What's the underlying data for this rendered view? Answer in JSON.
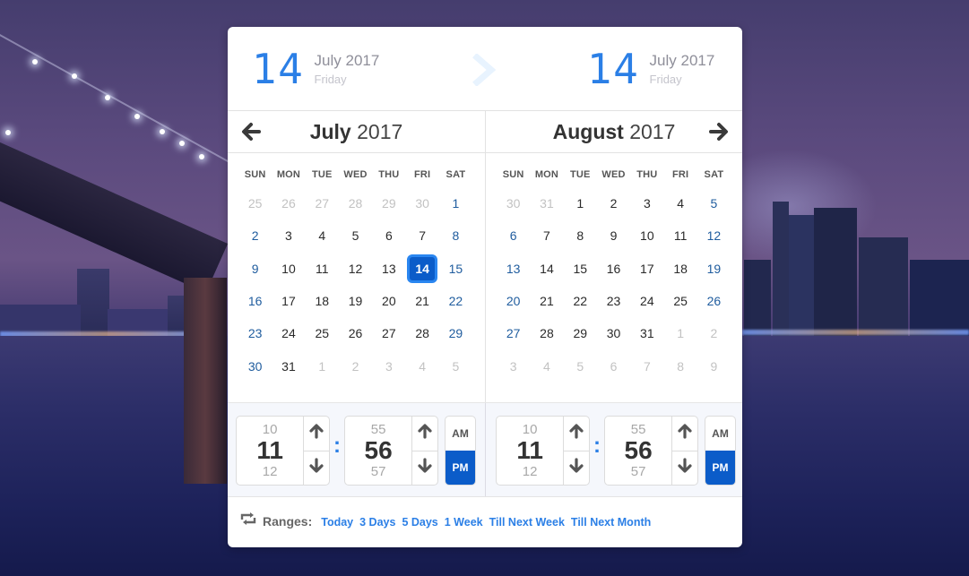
{
  "summary": {
    "start": {
      "day": "14",
      "month_year": "July 2017",
      "weekday": "Friday"
    },
    "end": {
      "day": "14",
      "month_year": "July 2017",
      "weekday": "Friday"
    }
  },
  "calendars": [
    {
      "month": "July",
      "year": "2017",
      "nav": "prev",
      "weekdays": [
        "SUN",
        "MON",
        "TUE",
        "WED",
        "THU",
        "FRI",
        "SAT"
      ],
      "days": [
        {
          "d": "25",
          "t": "muted"
        },
        {
          "d": "26",
          "t": "muted"
        },
        {
          "d": "27",
          "t": "muted"
        },
        {
          "d": "28",
          "t": "muted"
        },
        {
          "d": "29",
          "t": "muted"
        },
        {
          "d": "30",
          "t": "muted"
        },
        {
          "d": "1",
          "t": "weekend"
        },
        {
          "d": "2",
          "t": "weekend"
        },
        {
          "d": "3",
          "t": ""
        },
        {
          "d": "4",
          "t": ""
        },
        {
          "d": "5",
          "t": ""
        },
        {
          "d": "6",
          "t": ""
        },
        {
          "d": "7",
          "t": ""
        },
        {
          "d": "8",
          "t": "weekend"
        },
        {
          "d": "9",
          "t": "weekend"
        },
        {
          "d": "10",
          "t": ""
        },
        {
          "d": "11",
          "t": ""
        },
        {
          "d": "12",
          "t": ""
        },
        {
          "d": "13",
          "t": ""
        },
        {
          "d": "14",
          "t": "selected"
        },
        {
          "d": "15",
          "t": "weekend"
        },
        {
          "d": "16",
          "t": "weekend"
        },
        {
          "d": "17",
          "t": ""
        },
        {
          "d": "18",
          "t": ""
        },
        {
          "d": "19",
          "t": ""
        },
        {
          "d": "20",
          "t": ""
        },
        {
          "d": "21",
          "t": ""
        },
        {
          "d": "22",
          "t": "weekend"
        },
        {
          "d": "23",
          "t": "weekend"
        },
        {
          "d": "24",
          "t": ""
        },
        {
          "d": "25",
          "t": ""
        },
        {
          "d": "26",
          "t": ""
        },
        {
          "d": "27",
          "t": ""
        },
        {
          "d": "28",
          "t": ""
        },
        {
          "d": "29",
          "t": "weekend"
        },
        {
          "d": "30",
          "t": "weekend"
        },
        {
          "d": "31",
          "t": ""
        },
        {
          "d": "1",
          "t": "muted"
        },
        {
          "d": "2",
          "t": "muted"
        },
        {
          "d": "3",
          "t": "muted"
        },
        {
          "d": "4",
          "t": "muted"
        },
        {
          "d": "5",
          "t": "muted"
        }
      ]
    },
    {
      "month": "August",
      "year": "2017",
      "nav": "next",
      "weekdays": [
        "SUN",
        "MON",
        "TUE",
        "WED",
        "THU",
        "FRI",
        "SAT"
      ],
      "days": [
        {
          "d": "30",
          "t": "muted"
        },
        {
          "d": "31",
          "t": "muted"
        },
        {
          "d": "1",
          "t": ""
        },
        {
          "d": "2",
          "t": ""
        },
        {
          "d": "3",
          "t": ""
        },
        {
          "d": "4",
          "t": ""
        },
        {
          "d": "5",
          "t": "weekend"
        },
        {
          "d": "6",
          "t": "weekend"
        },
        {
          "d": "7",
          "t": ""
        },
        {
          "d": "8",
          "t": ""
        },
        {
          "d": "9",
          "t": ""
        },
        {
          "d": "10",
          "t": ""
        },
        {
          "d": "11",
          "t": ""
        },
        {
          "d": "12",
          "t": "weekend"
        },
        {
          "d": "13",
          "t": "weekend"
        },
        {
          "d": "14",
          "t": ""
        },
        {
          "d": "15",
          "t": ""
        },
        {
          "d": "16",
          "t": ""
        },
        {
          "d": "17",
          "t": ""
        },
        {
          "d": "18",
          "t": ""
        },
        {
          "d": "19",
          "t": "weekend"
        },
        {
          "d": "20",
          "t": "weekend"
        },
        {
          "d": "21",
          "t": ""
        },
        {
          "d": "22",
          "t": ""
        },
        {
          "d": "23",
          "t": ""
        },
        {
          "d": "24",
          "t": ""
        },
        {
          "d": "25",
          "t": ""
        },
        {
          "d": "26",
          "t": "weekend"
        },
        {
          "d": "27",
          "t": "weekend"
        },
        {
          "d": "28",
          "t": ""
        },
        {
          "d": "29",
          "t": ""
        },
        {
          "d": "30",
          "t": ""
        },
        {
          "d": "31",
          "t": ""
        },
        {
          "d": "1",
          "t": "muted"
        },
        {
          "d": "2",
          "t": "muted"
        },
        {
          "d": "3",
          "t": "muted"
        },
        {
          "d": "4",
          "t": "muted"
        },
        {
          "d": "5",
          "t": "muted"
        },
        {
          "d": "6",
          "t": "muted"
        },
        {
          "d": "7",
          "t": "muted"
        },
        {
          "d": "8",
          "t": "muted"
        },
        {
          "d": "9",
          "t": "muted"
        }
      ]
    }
  ],
  "times": [
    {
      "hour": {
        "prev": "10",
        "cur": "11",
        "next": "12"
      },
      "minute": {
        "prev": "55",
        "cur": "56",
        "next": "57"
      },
      "separator": ":",
      "am": "AM",
      "pm": "PM",
      "selected": "PM"
    },
    {
      "hour": {
        "prev": "10",
        "cur": "11",
        "next": "12"
      },
      "minute": {
        "prev": "55",
        "cur": "56",
        "next": "57"
      },
      "separator": ":",
      "am": "AM",
      "pm": "PM",
      "selected": "PM"
    }
  ],
  "ranges": {
    "icon": "repeat-icon",
    "label": "Ranges:",
    "links": [
      "Today",
      "3 Days",
      "5 Days",
      "1 Week",
      "Till Next Week",
      "Till Next Month"
    ]
  },
  "colors": {
    "accent": "#2b7fe6",
    "selected_bg": "#0b5cc9",
    "weekend": "#1f5c9e",
    "muted": "#c2c2c2"
  }
}
